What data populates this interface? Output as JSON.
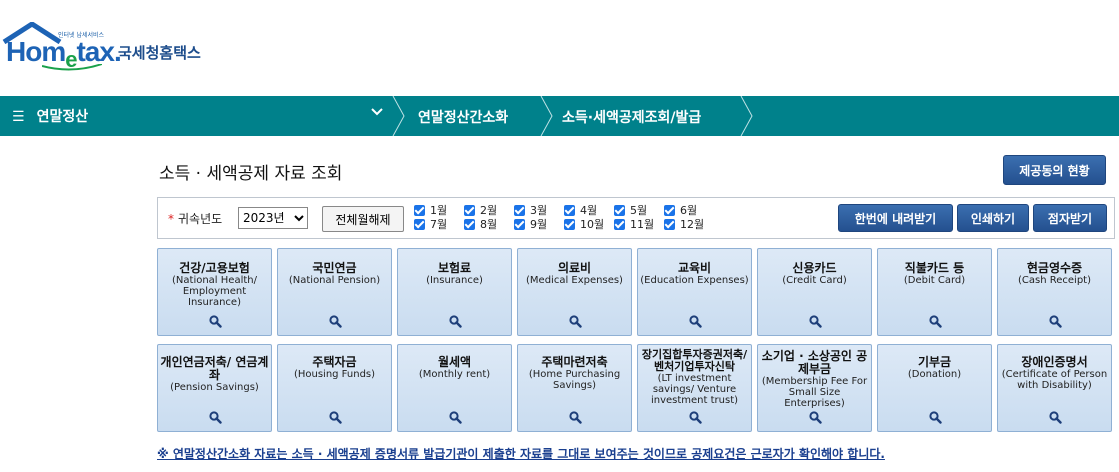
{
  "logo": {
    "sub_text": "인터넷 납세서비스",
    "home_text": "Hom",
    "e_text": "e",
    "tax_text": "tax.",
    "kr_text": "국세청홈택스",
    "house_color": "#1d63b5",
    "swoosh_color": "#1aa14a"
  },
  "nav": {
    "menu_icon": "☰",
    "menu_label": "연말정산",
    "chevron": "⌄",
    "crumb1": "연말정산간소화",
    "crumb2": "소득·세액공제조회/발급",
    "bar_color": "#00818b"
  },
  "page": {
    "title": "소득 · 세액공제 자료 조회",
    "co_button": "제공동의 현황"
  },
  "filter": {
    "year_label": "귀속년도",
    "year_value": "2023년",
    "toggle_all": "전체월해제",
    "months": [
      "1월",
      "2월",
      "3월",
      "4월",
      "5월",
      "6월",
      "7월",
      "8월",
      "9월",
      "10월",
      "11월",
      "12월"
    ],
    "download_all": "한번에 내려받기",
    "print": "인쇄하기",
    "braille": "점자받기"
  },
  "tiles": [
    {
      "title": "건강/고용보험",
      "en": "(National Health/ Employment Insurance)"
    },
    {
      "title": "국민연금",
      "en": "(National Pension)"
    },
    {
      "title": "보험료",
      "en": "(Insurance)"
    },
    {
      "title": "의료비",
      "en": "(Medical Expenses)"
    },
    {
      "title": "교육비",
      "en": "(Education Expenses)"
    },
    {
      "title": "신용카드",
      "en": "(Credit Card)"
    },
    {
      "title": "직불카드 등",
      "en": "(Debit Card)"
    },
    {
      "title": "현금영수증",
      "en": "(Cash Receipt)"
    },
    {
      "title": "개인연금저축/ 연금계좌",
      "en": "(Pension Savings)"
    },
    {
      "title": "주택자금",
      "en": "(Housing Funds)"
    },
    {
      "title": "월세액",
      "en": "(Monthly rent)"
    },
    {
      "title": "주택마련저축",
      "en": "(Home Purchasing Savings)"
    },
    {
      "title": "장기집합투자증권저축/ 벤처기업투자신탁",
      "en": "(LT investment savings/ Venture investment trust)"
    },
    {
      "title": "소기업 · 소상공인 공제부금",
      "en": "(Membership Fee For Small Size Enterprises)"
    },
    {
      "title": "기부금",
      "en": "(Donation)"
    },
    {
      "title": "장애인증명서",
      "en": "(Certificate of Person with Disability)"
    }
  ],
  "notice": "※ 연말정산간소화 자료는 소득 · 세액공제 증명서류 발급기관이 제출한 자료를 그대로 보여주는 것이므로 공제요건은 근로자가 확인해야 합니다."
}
